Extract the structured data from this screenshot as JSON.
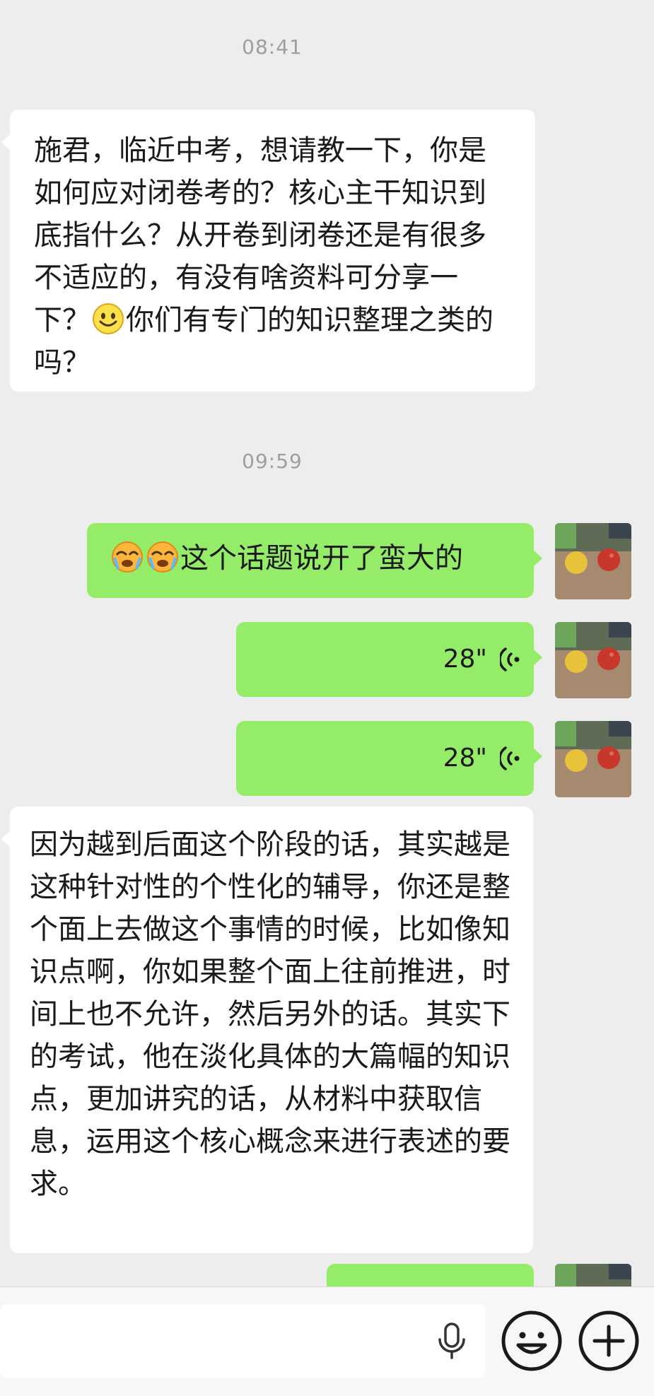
{
  "conversation": {
    "timestamps": [
      "08:41",
      "09:59"
    ],
    "messages": [
      {
        "direction": "incoming",
        "type": "text",
        "text_before": "施君，临近中考，想请教一下，你是如何应对闭卷考的？核心主干知识到底指什么？从开卷到闭卷还是有很多不适应的，有没有啥资料可分享一下？",
        "emoji": "smile-emoji",
        "text_after": "你们有专门的知识整理之类的吗？"
      },
      {
        "direction": "outgoing",
        "type": "text",
        "emoji": "facepalm-cry-emoji",
        "text": "这个话题说开了蛮大的"
      },
      {
        "direction": "outgoing",
        "type": "voice",
        "duration": "28\""
      },
      {
        "direction": "outgoing",
        "type": "voice",
        "duration": "28\""
      },
      {
        "direction": "incoming",
        "type": "text",
        "text": "因为越到后面这个阶段的话，其实越是这种针对性的个性化的辅导，你还是整个面上去做这个事情的时候，比如像知识点啊，你如果整个面上往前推进，时间上也不允许，然后另外的话。其实下的考试，他在淡化具体的大篇幅的知识点，更加讲究的话，从材料中获取信息，运用这个核心概念来进行表述的要求。"
      },
      {
        "direction": "outgoing",
        "type": "text",
        "text": ""
      }
    ]
  },
  "colors": {
    "background": "#ededed",
    "incoming_bubble": "#ffffff",
    "outgoing_bubble": "#95ec69",
    "timestamp": "#9e9e9e"
  },
  "icons": {
    "avatar": "apples-photo-avatar",
    "voice": "voice-wave-icon",
    "mic": "microphone-icon",
    "emoji_button": "emoji-face-icon",
    "plus_button": "plus-circle-icon"
  }
}
